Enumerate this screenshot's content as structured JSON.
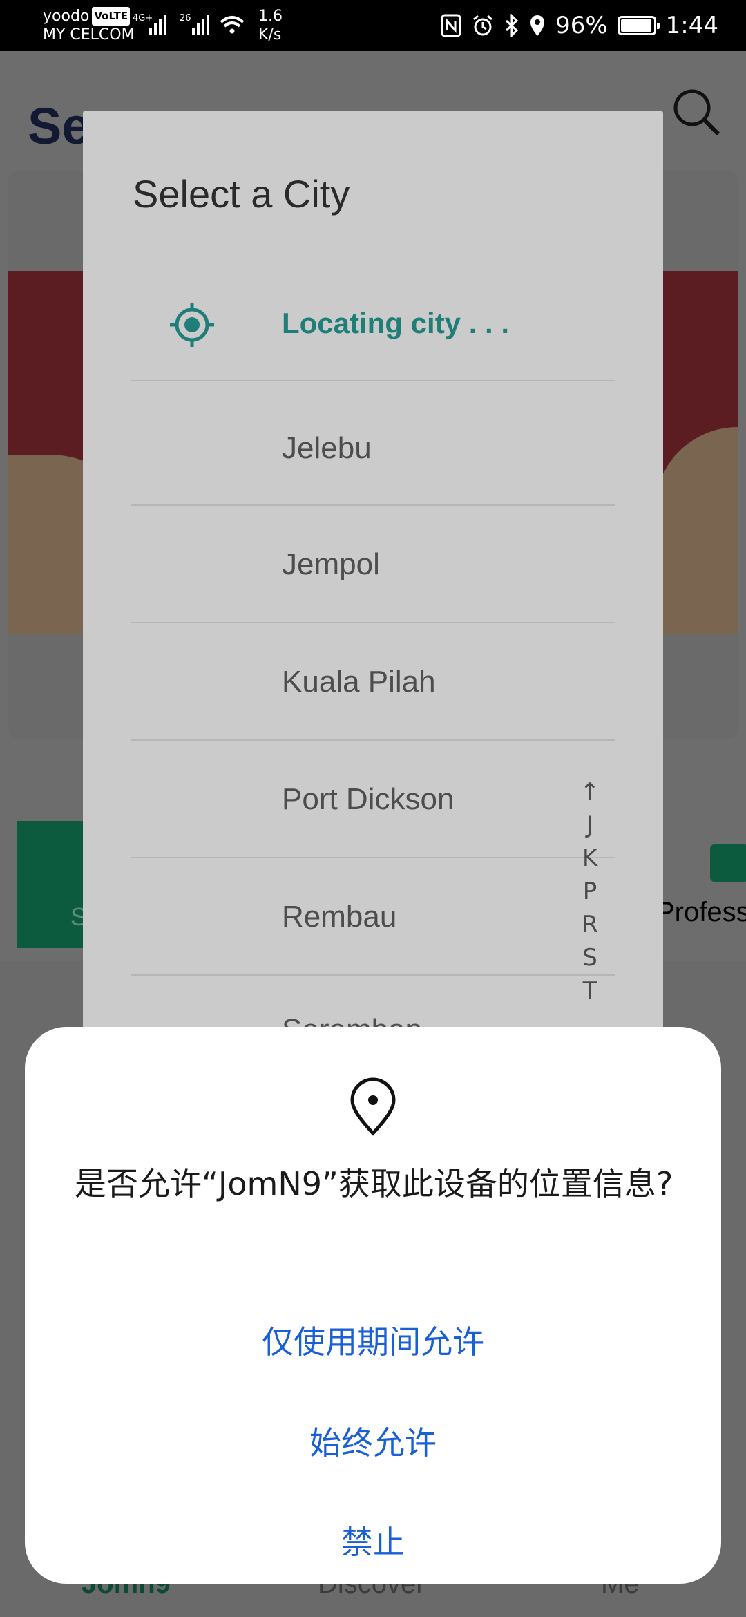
{
  "status_bar": {
    "carrier_top": "yoodo",
    "volte": "VoLTE",
    "carrier_bottom": "MY CELCOM",
    "net_a": "4G+",
    "net_b": "26",
    "speed_value": "1.6",
    "speed_unit": "K/s",
    "battery": "96%",
    "battery_level": 0.96,
    "time": "1:44"
  },
  "app_background": {
    "title_partial": "Se",
    "green_tile_partial": "S",
    "category_partial": "Profess",
    "nav": {
      "home": "Jomn9",
      "discover": "Discover",
      "me": "Me"
    }
  },
  "city_dialog": {
    "title": "Select a City",
    "locating_text": "Locating city . . .",
    "cities": [
      "Jelebu",
      "Jempol",
      "Kuala Pilah",
      "Port Dickson",
      "Rembau",
      "Seremban"
    ],
    "index": [
      "↑",
      "J",
      "K",
      "P",
      "R",
      "S",
      "T"
    ],
    "accent_color": "#1f7f78"
  },
  "permission_sheet": {
    "icon": "location-pin-icon",
    "question": "是否允许“JomN9”获取此设备的位置信息?",
    "allow_while_using": "仅使用期间允许",
    "always_allow": "始终允许",
    "deny": "禁止",
    "button_color": "#1a5fd6"
  }
}
